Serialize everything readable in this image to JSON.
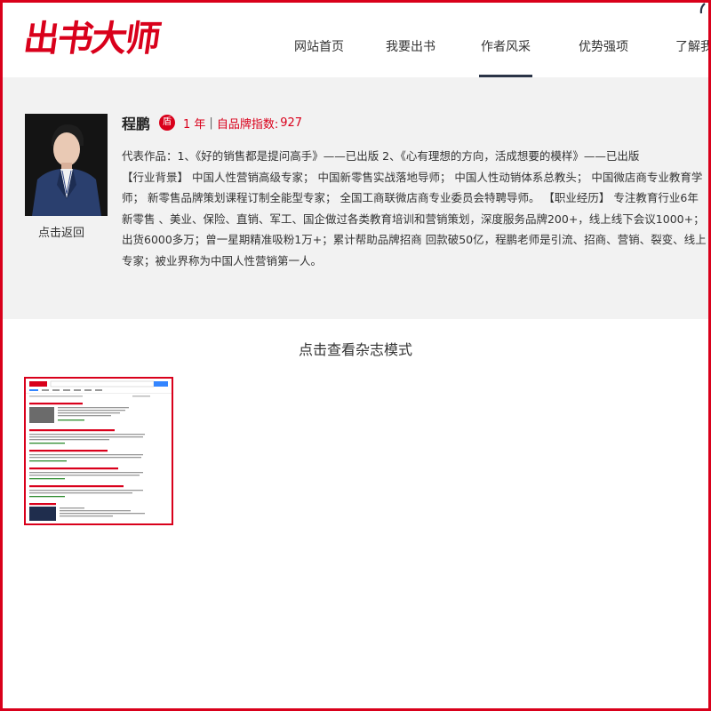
{
  "logo": {
    "text": "出书大师"
  },
  "nav": {
    "items": [
      {
        "label": "网站首页"
      },
      {
        "label": "我要出书"
      },
      {
        "label": "作者风采"
      },
      {
        "label": "优势强项"
      },
      {
        "label": "了解我们"
      }
    ],
    "active_index": 2
  },
  "author": {
    "name": "程鹏",
    "badge": "盾",
    "years": "1 年",
    "separator": "|",
    "brand_label": "自品牌指数:",
    "brand_value": "927",
    "back_label": "点击返回",
    "bio_lines": [
      "代表作品：1、《好的销售都是提问高手》——已出版 2、《心有理想的方向，活成想要的模样》——已出版",
      "【行业背景】 中国人性营销高级专家； 中国新零售实战落地导师； 中国人性动销体系总教头； 中国微店商专业教育学",
      "师； 新零售品牌策划课程订制全能型专家； 全国工商联微店商专业委员会特聘导师。 【职业经历】 专注教育行业6年",
      "新零售 、美业、保险、直销、军工、国企做过各类教育培训和营销策划，深度服务品牌200+，线上线下会议1000+；",
      "出货6000多万；曾一星期精准吸粉1万+；累计帮助品牌招商 回款破50亿，程鹏老师是引流、招商、营销、裂变、线上",
      "专家；被业界称为中国人性营销第一人。"
    ]
  },
  "magazine": {
    "title": "点击查看杂志模式"
  },
  "colors": {
    "brand_red": "#d9001b",
    "nav_underline": "#2a3447",
    "section_bg": "#f2f2f2"
  }
}
